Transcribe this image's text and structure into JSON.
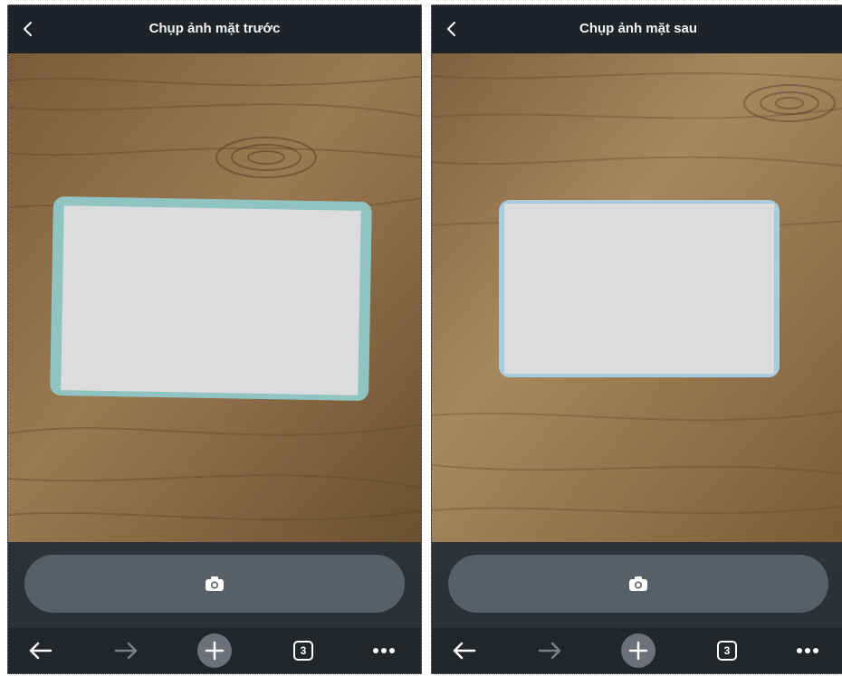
{
  "panels": [
    {
      "title": "Chụp ảnh mặt trước",
      "tabs_count": "3"
    },
    {
      "title": "Chụp ảnh mặt sau",
      "tabs_count": "3"
    }
  ],
  "icons": {
    "back": "chevron-left-icon",
    "camera": "camera-icon",
    "nav_back": "arrow-left-icon",
    "nav_forward": "arrow-right-icon",
    "new_tab": "plus-icon",
    "tabs": "tabs-icon",
    "more": "more-dots-icon"
  },
  "colors": {
    "header_bg": "#1f2329",
    "shutter_bg": "#576068",
    "nav_bg": "#22262b",
    "wood": "#8b6a42",
    "card_blank": "#dcdcdc"
  }
}
